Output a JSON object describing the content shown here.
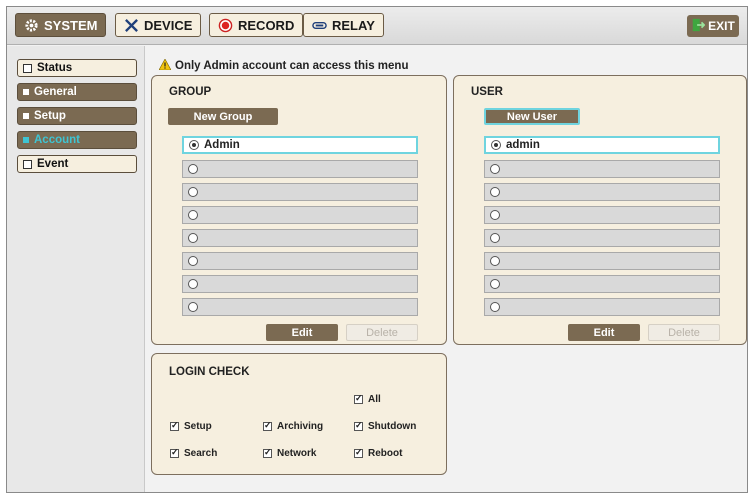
{
  "topbar": {
    "tabs": [
      {
        "label": "SYSTEM",
        "icon": "gear-icon",
        "active": true
      },
      {
        "label": "DEVICE",
        "icon": "tools-icon",
        "active": false
      },
      {
        "label": "RECORD",
        "icon": "record-icon",
        "active": false
      },
      {
        "label": "RELAY",
        "icon": "relay-icon",
        "active": false
      }
    ],
    "exit_label": "EXIT"
  },
  "sidebar": {
    "items": [
      {
        "label": "Status"
      },
      {
        "label": "General"
      },
      {
        "label": "Setup"
      },
      {
        "label": "Account",
        "selected": true
      },
      {
        "label": "Event"
      }
    ]
  },
  "notice": "Only Admin account can access this menu",
  "group": {
    "title": "GROUP",
    "new_button": "New Group",
    "rows": [
      "Admin",
      "",
      "",
      "",
      "",
      "",
      "",
      ""
    ],
    "edit_label": "Edit",
    "delete_label": "Delete"
  },
  "user": {
    "title": "USER",
    "new_button": "New User",
    "rows": [
      "admin",
      "",
      "",
      "",
      "",
      "",
      "",
      ""
    ],
    "edit_label": "Edit",
    "delete_label": "Delete"
  },
  "login_check": {
    "title": "LOGIN CHECK",
    "options": {
      "all": "All",
      "setup": "Setup",
      "archiving": "Archiving",
      "shutdown": "Shutdown",
      "search": "Search",
      "network": "Network",
      "reboot": "Reboot"
    }
  },
  "colors": {
    "accent_brown": "#7b6a52",
    "panel_bg": "#f6efdf",
    "highlight_cyan": "#6fd4df",
    "exit_green": "#3fa63f"
  }
}
